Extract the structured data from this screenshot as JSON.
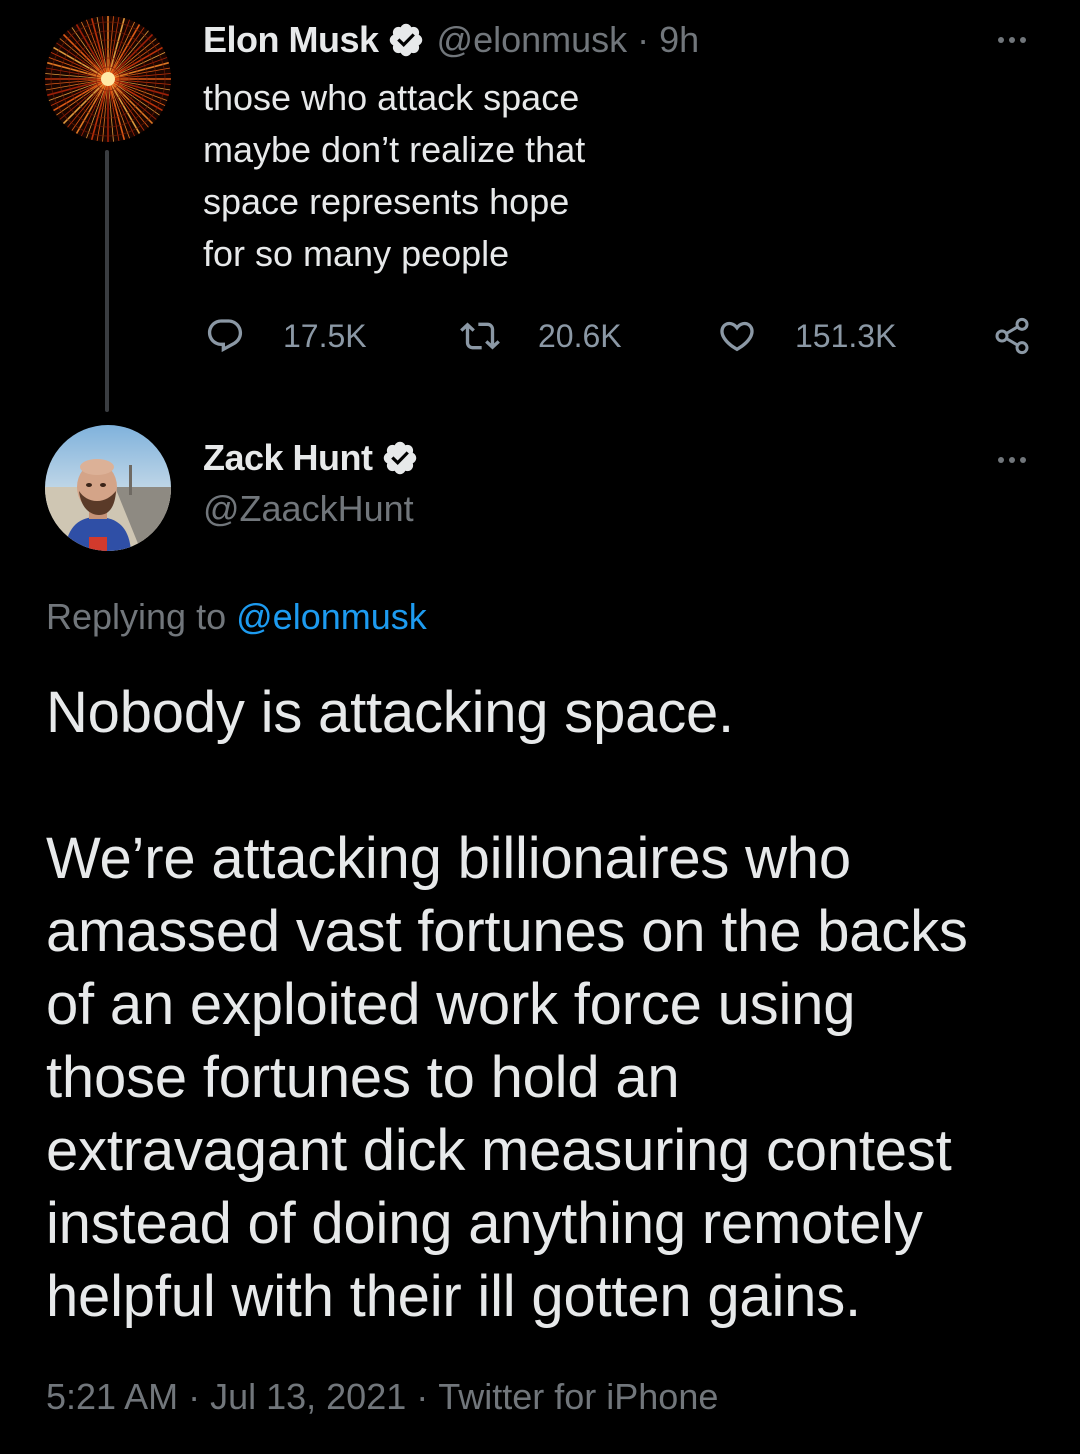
{
  "colors": {
    "background": "#000000",
    "primary_text": "#e7e9ea",
    "secondary_text": "#71767b",
    "link": "#1d9bf0",
    "verified_badge": "#e7e9ea",
    "thread_line": "#3a3d41"
  },
  "parent_tweet": {
    "author_name": "Elon Musk",
    "handle": "@elonmusk",
    "separator": "·",
    "time_ago": "9h",
    "verified": true,
    "text_lines": [
      "those who attack space",
      "maybe don’t realize that",
      "space represents hope",
      "for so many people"
    ],
    "actions": {
      "replies": {
        "icon": "reply-icon",
        "count": "17.5K"
      },
      "retweets": {
        "icon": "retweet-icon",
        "count": "20.6K"
      },
      "likes": {
        "icon": "heart-icon",
        "count": "151.3K"
      },
      "share": {
        "icon": "share-icon"
      }
    }
  },
  "reply_tweet": {
    "author_name": "Zack Hunt",
    "handle": "@ZaackHunt",
    "verified": true,
    "replying_to_label": "Replying to",
    "replying_to_handle": "@elonmusk",
    "paragraph1": "Nobody is attacking space.",
    "paragraph2_lines": [
      "We’re attacking billionaires who",
      "amassed vast fortunes on the backs",
      "of an exploited work force using",
      "those fortunes to hold an",
      "extravagant dick measuring contest",
      "instead of doing anything remotely",
      "helpful with their ill gotten gains."
    ],
    "time": "5:21 AM",
    "date": "Jul 13, 2021",
    "source": "Twitter for iPhone",
    "separator": "·"
  }
}
